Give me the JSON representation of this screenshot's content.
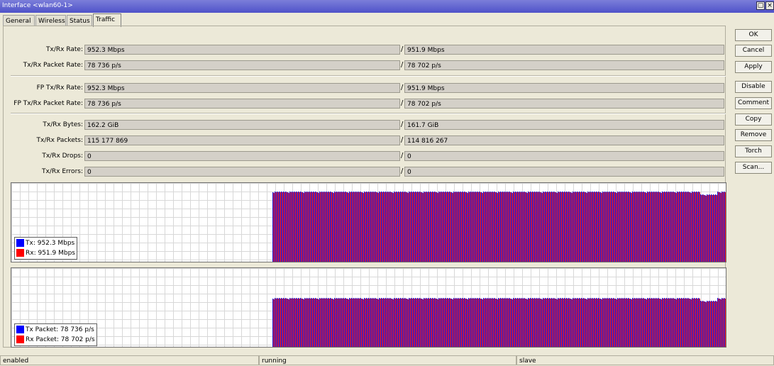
{
  "window": {
    "title": "Interface <wlan60-1>",
    "restore_glyph": "▢",
    "close_glyph": "×"
  },
  "tabs": [
    {
      "label": "General"
    },
    {
      "label": "Wireless"
    },
    {
      "label": "Status"
    },
    {
      "label": "Traffic",
      "active": true
    }
  ],
  "fields": [
    {
      "label": "Tx/Rx Rate:",
      "tx": "952.3 Mbps",
      "rx": "951.9 Mbps"
    },
    {
      "label": "Tx/Rx Packet Rate:",
      "tx": "78 736 p/s",
      "rx": "78 702 p/s"
    },
    {
      "label": "FP Tx/Rx Rate:",
      "tx": "952.3 Mbps",
      "rx": "951.9 Mbps"
    },
    {
      "label": "FP Tx/Rx Packet Rate:",
      "tx": "78 736 p/s",
      "rx": "78 702 p/s"
    },
    {
      "label": "Tx/Rx Bytes:",
      "tx": "162.2 GiB",
      "rx": "161.7 GiB"
    },
    {
      "label": "Tx/Rx Packets:",
      "tx": "115 177 869",
      "rx": "114 816 267"
    },
    {
      "label": "Tx/Rx Drops:",
      "tx": "0",
      "rx": "0"
    },
    {
      "label": "Tx/Rx Errors:",
      "tx": "0",
      "rx": "0"
    }
  ],
  "separator": "/",
  "buttons": [
    "OK",
    "Cancel",
    "Apply",
    "Disable",
    "Comment",
    "Copy",
    "Remove",
    "Torch",
    "Scan..."
  ],
  "graphs": {
    "rate": {
      "legend": [
        {
          "label": "Tx:  952.3 Mbps",
          "color": "#0000ff"
        },
        {
          "label": "Rx:  951.9 Mbps",
          "color": "#ff0000"
        }
      ]
    },
    "packets": {
      "legend": [
        {
          "label": "Tx Packet:  78 736 p/s",
          "color": "#0000ff"
        },
        {
          "label": "Rx Packet:  78 702 p/s",
          "color": "#ff0000"
        }
      ]
    }
  },
  "status": {
    "state": "enabled",
    "running": "running",
    "role": "slave"
  }
}
